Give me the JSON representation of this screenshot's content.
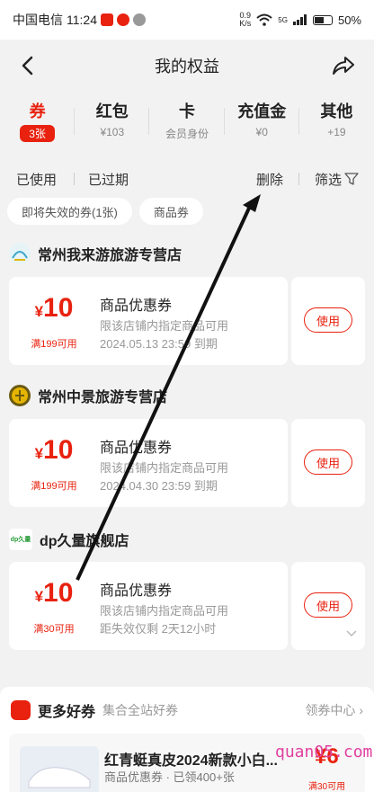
{
  "status_bar": {
    "carrier": "中国电信",
    "time": "11:24",
    "net_speed_value": "0.9",
    "net_speed_unit": "K/s",
    "signal": "5G",
    "battery": "50%"
  },
  "header": {
    "title": "我的权益"
  },
  "tabs": [
    {
      "label": "券",
      "sub": "3张",
      "active": true
    },
    {
      "label": "红包",
      "sub": "¥103"
    },
    {
      "label": "卡",
      "sub": "会员身份"
    },
    {
      "label": "充值金",
      "sub": "¥0"
    },
    {
      "label": "其他",
      "sub": "+19"
    }
  ],
  "filters": {
    "used": "已使用",
    "expired": "已过期",
    "delete": "删除",
    "filter": "筛选"
  },
  "chips": [
    "即将失效的券(1张)",
    "商品券"
  ],
  "stores": [
    {
      "name": "常州我来游旅游专营店",
      "coupon": {
        "currency": "¥",
        "amount": "10",
        "condition": "满199可用",
        "type": "商品优惠券",
        "scope": "限该店铺内指定商品可用",
        "expiry": "2024.05.13 23:59 到期",
        "button": "使用"
      }
    },
    {
      "name": "常州中景旅游专营店",
      "coupon": {
        "currency": "¥",
        "amount": "10",
        "condition": "满199可用",
        "type": "商品优惠券",
        "scope": "限该店铺内指定商品可用",
        "expiry": "2024.04.30 23:59 到期",
        "button": "使用"
      }
    },
    {
      "name": "dp久量旗舰店",
      "logo_text": "dp久量",
      "coupon": {
        "currency": "¥",
        "amount": "10",
        "condition": "满30可用",
        "type": "商品优惠券",
        "scope": "限该店铺内指定商品可用",
        "expiry": "距失效仅剩 2天12小时",
        "button": "使用"
      }
    }
  ],
  "more": {
    "title": "更多好券",
    "subtitle": "集合全站好券",
    "center_link": "领券中心 ›",
    "product": {
      "title": "红青蜓真皮2024新款小白...",
      "meta": "商品优惠券 · 已领400+张",
      "price": "¥6",
      "condition": "满30可用"
    }
  },
  "watermark": "quan05.com",
  "colors": {
    "accent": "#e8220f",
    "background": "#f2f2f2",
    "card": "#ffffff"
  }
}
